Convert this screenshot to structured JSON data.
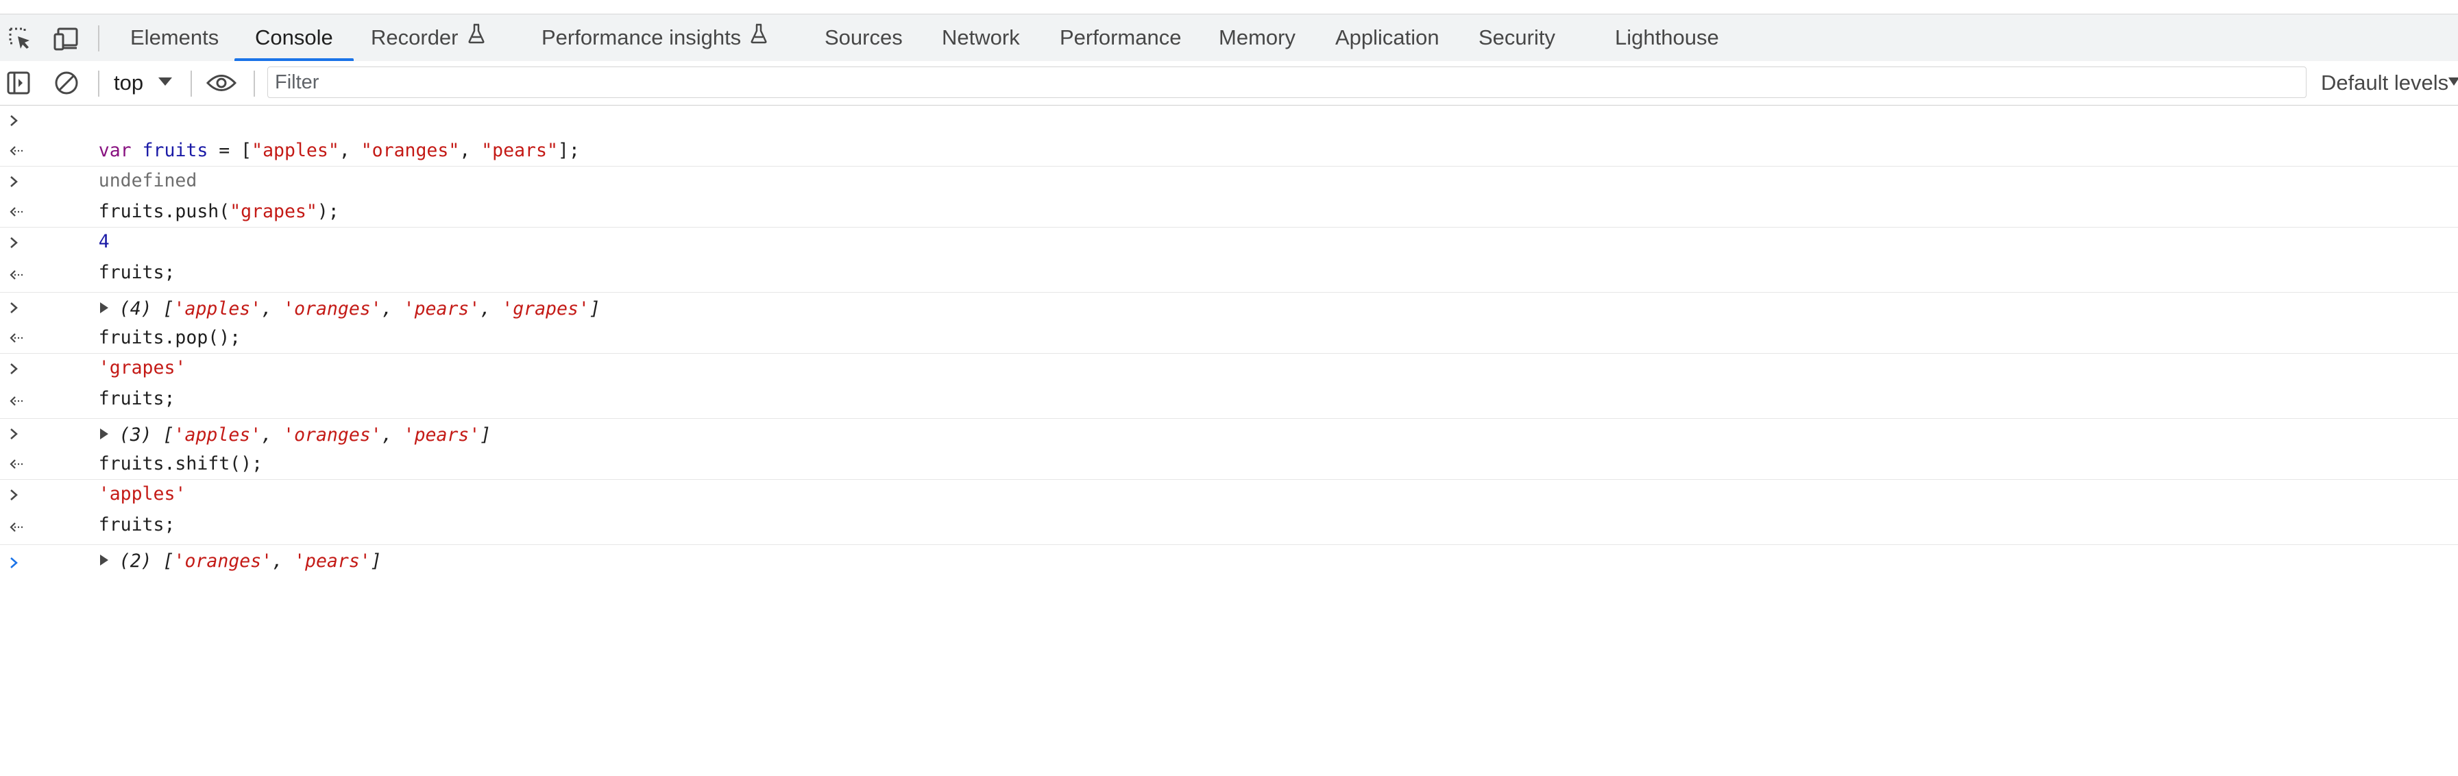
{
  "tabs": [
    {
      "label": "Elements"
    },
    {
      "label": "Console",
      "active": true
    },
    {
      "label": "Recorder",
      "flask": true
    },
    {
      "label": "Performance insights",
      "flask": true
    },
    {
      "label": "Sources"
    },
    {
      "label": "Network"
    },
    {
      "label": "Performance"
    },
    {
      "label": "Memory"
    },
    {
      "label": "Application"
    },
    {
      "label": "Security"
    },
    {
      "label": "Lighthouse"
    }
  ],
  "toolbar": {
    "context": "top",
    "filter_placeholder": "Filter",
    "levels": "Default levels"
  },
  "console": {
    "entries": [
      {
        "input": {
          "kw": "var",
          "name": "fruits",
          "eq": " = [",
          "s1": "\"apples\"",
          "c1": ", ",
          "s2": "\"oranges\"",
          "c2": ", ",
          "s3": "\"pears\"",
          "end": "];"
        },
        "result": "undefined"
      },
      {
        "input": {
          "pre": "fruits.push(",
          "s1": "\"grapes\"",
          "end": ");"
        },
        "result": "4"
      },
      {
        "input": {
          "text": "fruits;"
        },
        "result": {
          "count": "(4)",
          "open": "[",
          "items": [
            "'apples'",
            "'oranges'",
            "'pears'",
            "'grapes'"
          ],
          "sep": ", ",
          "close": "]"
        }
      },
      {
        "input": {
          "text": "fruits.pop();"
        },
        "result": "'grapes'"
      },
      {
        "input": {
          "text": "fruits;"
        },
        "result": {
          "count": "(3)",
          "open": "[",
          "items": [
            "'apples'",
            "'oranges'",
            "'pears'"
          ],
          "sep": ", ",
          "close": "]"
        }
      },
      {
        "input": {
          "text": "fruits.shift();"
        },
        "result": "'apples'"
      },
      {
        "input": {
          "text": "fruits;"
        },
        "result": {
          "count": "(2)",
          "open": "[",
          "items": [
            "'oranges'",
            "'pears'"
          ],
          "sep": ", ",
          "close": "]"
        }
      }
    ]
  },
  "colors": {
    "accent": "#1a73e8",
    "keyword": "#881280",
    "string": "#c41a16",
    "number": "#1a1aa6"
  },
  "icons": [
    "inspect-element-icon",
    "device-toggle-icon",
    "flask-icon",
    "sidebar-toggle-icon",
    "clear-console-icon",
    "dropdown-arrow-icon",
    "eye-icon",
    "prompt-chevron-icon",
    "result-arrow-icon",
    "expand-triangle-icon"
  ]
}
